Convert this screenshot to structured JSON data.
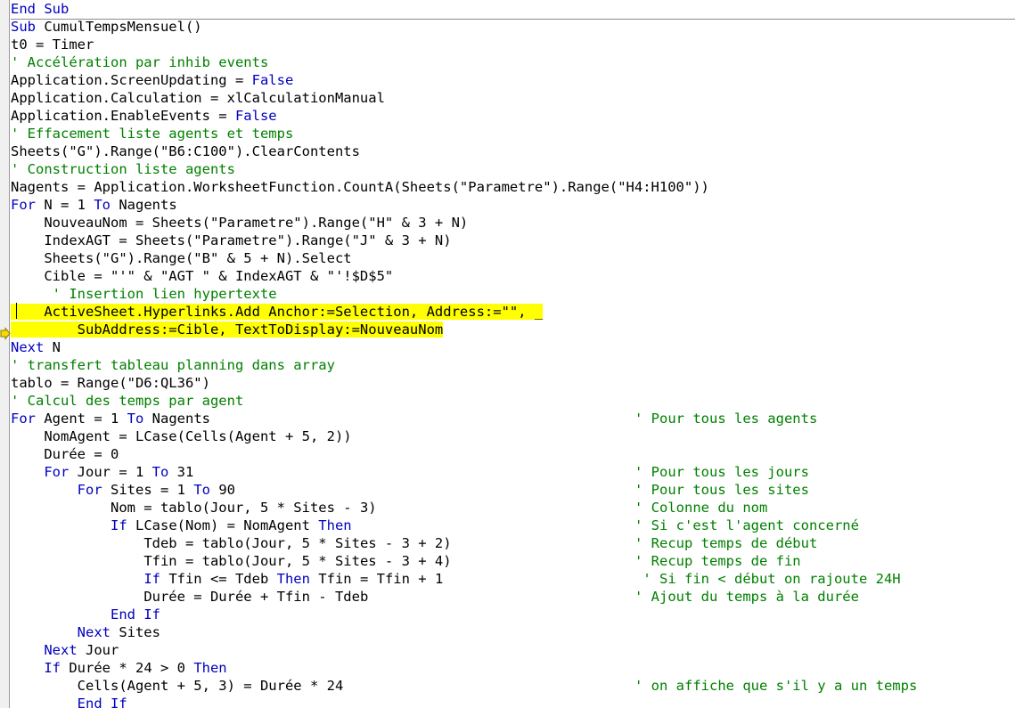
{
  "editor": {
    "app": "vba-code-editor",
    "language": "VBA",
    "colors": {
      "keyword": "#0000C0",
      "comment": "#008000",
      "plain": "#000000",
      "selection_background": "#FFFF00",
      "background": "#FFFFFF",
      "margin": "#F0F0F0",
      "separator": "#8A8A8A",
      "current_statement_arrow": "#FFD700"
    },
    "margin": {
      "current_statement_indicator": "current-statement-arrow"
    },
    "caret": {
      "line_index": 17,
      "column": 4
    }
  },
  "lines": [
    {
      "indent": 0,
      "parts": [
        {
          "t": "kw",
          "s": "End Sub"
        }
      ]
    },
    {
      "indent": 0,
      "separator_above": true,
      "parts": [
        {
          "t": "kw",
          "s": "Sub"
        },
        {
          "t": "pl",
          "s": " CumulTempsMensuel()"
        }
      ]
    },
    {
      "indent": 0,
      "parts": [
        {
          "t": "pl",
          "s": "t0 = Timer"
        }
      ]
    },
    {
      "indent": 0,
      "parts": [
        {
          "t": "cm",
          "s": "' Accélération par inhib events"
        }
      ]
    },
    {
      "indent": 0,
      "parts": [
        {
          "t": "pl",
          "s": "Application.ScreenUpdating = "
        },
        {
          "t": "kw",
          "s": "False"
        }
      ]
    },
    {
      "indent": 0,
      "parts": [
        {
          "t": "pl",
          "s": "Application.Calculation = xlCalculationManual"
        }
      ]
    },
    {
      "indent": 0,
      "parts": [
        {
          "t": "pl",
          "s": "Application.EnableEvents = "
        },
        {
          "t": "kw",
          "s": "False"
        }
      ]
    },
    {
      "indent": 0,
      "parts": [
        {
          "t": "cm",
          "s": "' Effacement liste agents et temps"
        }
      ]
    },
    {
      "indent": 0,
      "parts": [
        {
          "t": "pl",
          "s": "Sheets(\"G\").Range(\"B6:C100\").ClearContents"
        }
      ]
    },
    {
      "indent": 0,
      "parts": [
        {
          "t": "cm",
          "s": "' Construction liste agents"
        }
      ]
    },
    {
      "indent": 0,
      "parts": [
        {
          "t": "pl",
          "s": "Nagents = Application.WorksheetFunction.CountA(Sheets(\"Parametre\").Range(\"H4:H100\"))"
        }
      ]
    },
    {
      "indent": 0,
      "parts": [
        {
          "t": "kw",
          "s": "For"
        },
        {
          "t": "pl",
          "s": " N = 1 "
        },
        {
          "t": "kw",
          "s": "To"
        },
        {
          "t": "pl",
          "s": " Nagents"
        }
      ]
    },
    {
      "indent": 4,
      "parts": [
        {
          "t": "pl",
          "s": "NouveauNom = Sheets(\"Parametre\").Range(\"H\" & 3 + N)"
        }
      ]
    },
    {
      "indent": 4,
      "parts": [
        {
          "t": "pl",
          "s": "IndexAGT = Sheets(\"Parametre\").Range(\"J\" & 3 + N)"
        }
      ]
    },
    {
      "indent": 4,
      "parts": [
        {
          "t": "pl",
          "s": "Sheets(\"G\").Range(\"B\" & 5 + N).Select"
        }
      ]
    },
    {
      "indent": 4,
      "parts": [
        {
          "t": "pl",
          "s": "Cible = \"'\" & \"AGT \" & IndexAGT & \"'!$D$5\""
        }
      ]
    },
    {
      "indent": 5,
      "parts": [
        {
          "t": "cm",
          "s": "' Insertion lien hypertexte"
        }
      ]
    },
    {
      "indent": 4,
      "highlight": true,
      "parts": [
        {
          "t": "pl",
          "s": "ActiveSheet.Hyperlinks.Add Anchor:=Selection, Address:=\"\", _"
        }
      ]
    },
    {
      "indent": 8,
      "highlight": true,
      "parts": [
        {
          "t": "pl",
          "s": "SubAddress:=Cible, TextToDisplay:=NouveauNom"
        }
      ]
    },
    {
      "indent": 0,
      "parts": [
        {
          "t": "kw",
          "s": "Next"
        },
        {
          "t": "pl",
          "s": " N"
        }
      ]
    },
    {
      "indent": 0,
      "parts": [
        {
          "t": "cm",
          "s": "' transfert tableau planning dans array"
        }
      ]
    },
    {
      "indent": 0,
      "parts": [
        {
          "t": "pl",
          "s": "tablo = Range(\"D6:QL36\")"
        }
      ]
    },
    {
      "indent": 0,
      "parts": [
        {
          "t": "cm",
          "s": "' Calcul des temps par agent"
        }
      ]
    },
    {
      "indent": 0,
      "right_comment": "' Pour tous les agents",
      "parts": [
        {
          "t": "kw",
          "s": "For"
        },
        {
          "t": "pl",
          "s": " Agent = 1 "
        },
        {
          "t": "kw",
          "s": "To"
        },
        {
          "t": "pl",
          "s": " Nagents"
        }
      ]
    },
    {
      "indent": 4,
      "parts": [
        {
          "t": "pl",
          "s": "NomAgent = LCase(Cells(Agent + 5, 2))"
        }
      ]
    },
    {
      "indent": 4,
      "parts": [
        {
          "t": "pl",
          "s": "Durée = 0"
        }
      ]
    },
    {
      "indent": 4,
      "right_comment": "' Pour tous les jours",
      "parts": [
        {
          "t": "kw",
          "s": "For"
        },
        {
          "t": "pl",
          "s": " Jour = 1 "
        },
        {
          "t": "kw",
          "s": "To"
        },
        {
          "t": "pl",
          "s": " 31"
        }
      ]
    },
    {
      "indent": 8,
      "right_comment": "' Pour tous les sites",
      "parts": [
        {
          "t": "kw",
          "s": "For"
        },
        {
          "t": "pl",
          "s": " Sites = 1 "
        },
        {
          "t": "kw",
          "s": "To"
        },
        {
          "t": "pl",
          "s": " 90"
        }
      ]
    },
    {
      "indent": 12,
      "right_comment": "' Colonne du nom",
      "parts": [
        {
          "t": "pl",
          "s": "Nom = tablo(Jour, 5 * Sites - 3)"
        }
      ]
    },
    {
      "indent": 12,
      "right_comment": "' Si c'est l'agent concerné",
      "parts": [
        {
          "t": "kw",
          "s": "If"
        },
        {
          "t": "pl",
          "s": " LCase(Nom) = NomAgent "
        },
        {
          "t": "kw",
          "s": "Then"
        }
      ]
    },
    {
      "indent": 16,
      "right_comment": "' Recup temps de début",
      "parts": [
        {
          "t": "pl",
          "s": "Tdeb = tablo(Jour, 5 * Sites - 3 + 2)"
        }
      ]
    },
    {
      "indent": 16,
      "right_comment": "' Recup temps de fin",
      "parts": [
        {
          "t": "pl",
          "s": "Tfin = tablo(Jour, 5 * Sites - 3 + 4)"
        }
      ]
    },
    {
      "indent": 16,
      "right_comment": " ' Si fin < début on rajoute 24H",
      "parts": [
        {
          "t": "kw",
          "s": "If"
        },
        {
          "t": "pl",
          "s": " Tfin <= Tdeb "
        },
        {
          "t": "kw",
          "s": "Then"
        },
        {
          "t": "pl",
          "s": " Tfin = Tfin + 1"
        }
      ]
    },
    {
      "indent": 16,
      "right_comment": "' Ajout du temps à la durée",
      "parts": [
        {
          "t": "pl",
          "s": "Durée = Durée + Tfin - Tdeb"
        }
      ]
    },
    {
      "indent": 12,
      "parts": [
        {
          "t": "kw",
          "s": "End If"
        }
      ]
    },
    {
      "indent": 8,
      "parts": [
        {
          "t": "kw",
          "s": "Next"
        },
        {
          "t": "pl",
          "s": " Sites"
        }
      ]
    },
    {
      "indent": 4,
      "parts": [
        {
          "t": "kw",
          "s": "Next"
        },
        {
          "t": "pl",
          "s": " Jour"
        }
      ]
    },
    {
      "indent": 4,
      "parts": [
        {
          "t": "kw",
          "s": "If"
        },
        {
          "t": "pl",
          "s": " Durée * 24 > 0 "
        },
        {
          "t": "kw",
          "s": "Then"
        }
      ]
    },
    {
      "indent": 8,
      "right_comment": "' on affiche que s'il y a un temps",
      "parts": [
        {
          "t": "pl",
          "s": "Cells(Agent + 5, 3) = Durée * 24"
        }
      ]
    },
    {
      "indent": 8,
      "clipped": true,
      "parts": [
        {
          "t": "kw",
          "s": "End If"
        }
      ]
    }
  ]
}
